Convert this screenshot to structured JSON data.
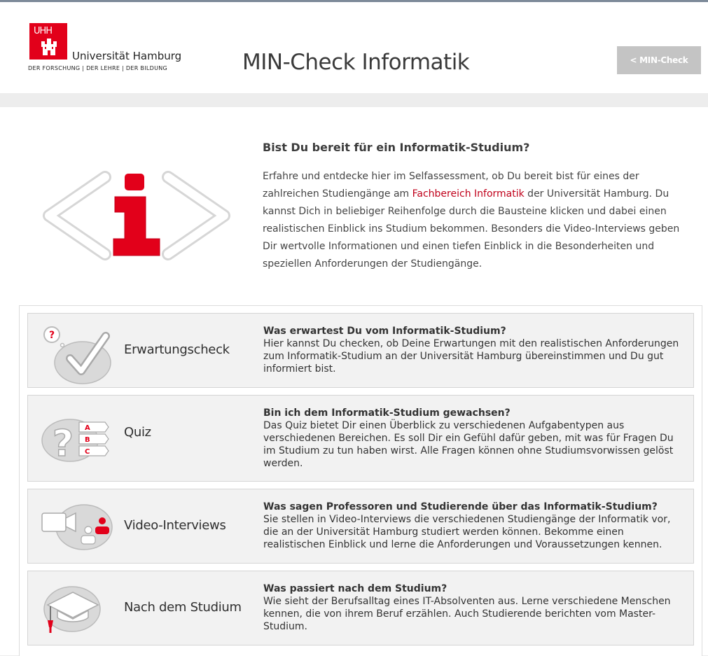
{
  "header": {
    "logo": {
      "mark": "UHH",
      "name": "Universität Hamburg",
      "tagline": "DER FORSCHUNG | DER LEHRE | DER BILDUNG"
    },
    "title": "MIN-Check Informatik",
    "back_button": "< MIN-Check"
  },
  "intro": {
    "title": "Bist Du bereit für ein Informatik-Studium?",
    "text_before_link": "Erfahre und entdecke hier im Selfassessment, ob Du bereit bist für eines der zahlreichen Studiengänge am ",
    "link": "Fachbereich Informatik",
    "text_after_link": " der Universität Hamburg. Du kannst Dich in beliebiger Reihenfolge durch die Bausteine klicken und dabei einen realistischen Einblick ins Studium bekommen. Besonders die Video-Interviews geben Dir wertvolle Informationen und einen tiefen Einblick in die Besonderheiten und speziellen Anforderungen der Studiengänge."
  },
  "cards": [
    {
      "label": "Erwartungscheck",
      "icon": "checkmark-icon",
      "heading": "Was erwartest Du vom Informatik-Studium?",
      "body": "Hier kannst Du checken, ob Deine Erwartungen mit den realistischen Anforderungen zum Informatik-Studium an der Universität Hamburg übereinstimmen und Du gut informiert bist."
    },
    {
      "label": "Quiz",
      "icon": "quiz-icon",
      "heading": "Bin ich dem Informatik-Studium gewachsen?",
      "body": "Das Quiz bietet Dir einen Überblick zu verschiedenen Aufgabentypen aus verschiedenen Bereichen. Es soll Dir ein Gefühl dafür geben, mit was für Fragen Du im Studium zu tun haben wirst. Alle Fragen können ohne Studiumsvorwissen gelöst werden."
    },
    {
      "label": "Video-Interviews",
      "icon": "video-camera-icon",
      "heading": "Was sagen Professoren und Studierende über das Informatik-Studium?",
      "body": "Sie stellen in Video-Interviews die verschiedenen Studiengänge der Informatik vor, die an der Universität Hamburg studiert werden können. Bekomme einen realistischen Einblick und lerne die Anforderungen und Voraussetzungen kennen."
    },
    {
      "label": "Nach dem Studium",
      "icon": "graduation-cap-icon",
      "heading": "Was passiert nach dem Studium?",
      "body": "Wie sieht der Berufsalltag eines IT-Absolventen aus. Lerne verschiedene Menschen kennen, die von ihrem Beruf erzählen. Auch Studierende berichten vom Master-Studium."
    }
  ],
  "quiz_options": [
    "A",
    "B",
    "C"
  ],
  "colors": {
    "accent": "#e2001a",
    "button": "#c4c4c4",
    "card_bg": "#f2f2f2"
  }
}
